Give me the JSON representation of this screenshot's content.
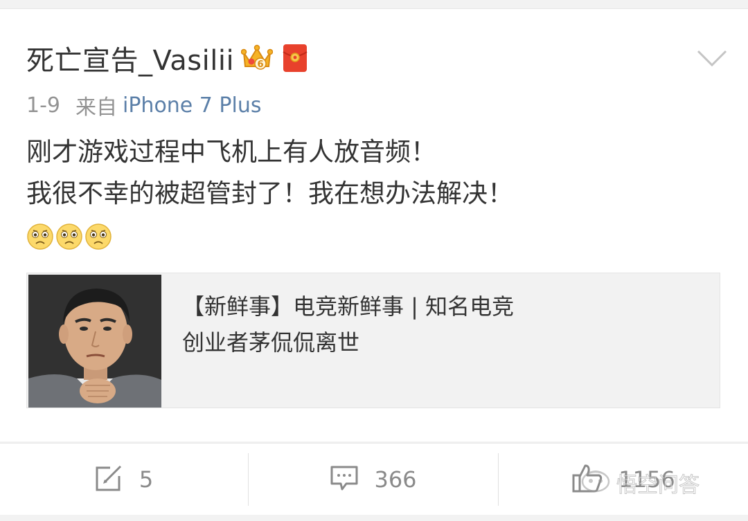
{
  "post": {
    "username": "死亡宣告_Vasilii",
    "crown_level": "6",
    "date": "1-9",
    "from_label": "来自",
    "device": "iPhone 7 Plus",
    "text_lines": [
      "刚才游戏过程中飞机上有人放音频！",
      "我很不幸的被超管封了！我在想办法解决！"
    ],
    "emojis": [
      "sad-face-icon",
      "sad-face-icon",
      "sad-face-icon"
    ]
  },
  "link_card": {
    "title_lines": [
      "【新鲜事】电竞新鲜事 | 知名电竞",
      "创业者茅侃侃离世"
    ]
  },
  "actions": {
    "repost_count": "5",
    "comment_count": "366",
    "like_count": "1156"
  },
  "watermark": {
    "text": "悟空问答"
  },
  "colors": {
    "text": "#333333",
    "muted": "#939393",
    "link": "#5b7fa8",
    "background": "#f2f2f2",
    "badge_red": "#e8412c",
    "badge_gold": "#f5b326"
  }
}
